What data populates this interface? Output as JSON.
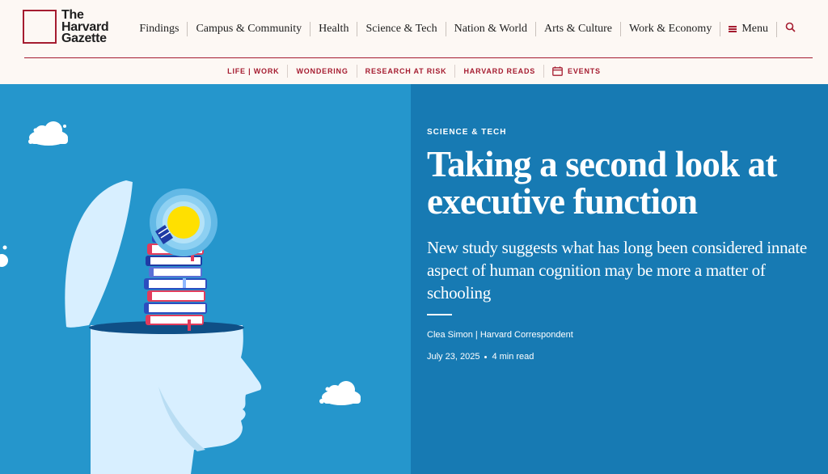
{
  "brand": {
    "line1": "The",
    "line2": "Harvard",
    "line3": "Gazette",
    "color": "#a51c30"
  },
  "main_nav": {
    "items": [
      "Findings",
      "Campus & Community",
      "Health",
      "Science & Tech",
      "Nation & World",
      "Arts & Culture",
      "Work & Economy"
    ],
    "menu_label": "Menu",
    "menu_icon": "hamburger-icon",
    "search_icon": "search-icon"
  },
  "sub_nav": {
    "items": [
      "LIFE | WORK",
      "WONDERING",
      "RESEARCH AT RISK",
      "HARVARD READS",
      "EVENTS"
    ],
    "events_icon": "calendar-icon"
  },
  "article": {
    "kicker": "SCIENCE & TECH",
    "title": "Taking a second look at executive function",
    "subtitle": "New study suggests what has long been considered innate aspect of human cognition may be more a matter of schooling",
    "byline": "Clea Simon | Harvard Correspondent",
    "date": "July 23, 2025",
    "read_time": "4 min read"
  },
  "colors": {
    "header_bg": "#fdf8f4",
    "hero_left_bg": "#2596cc",
    "hero_right_bg": "#177ab3",
    "accent": "#a51c30"
  }
}
